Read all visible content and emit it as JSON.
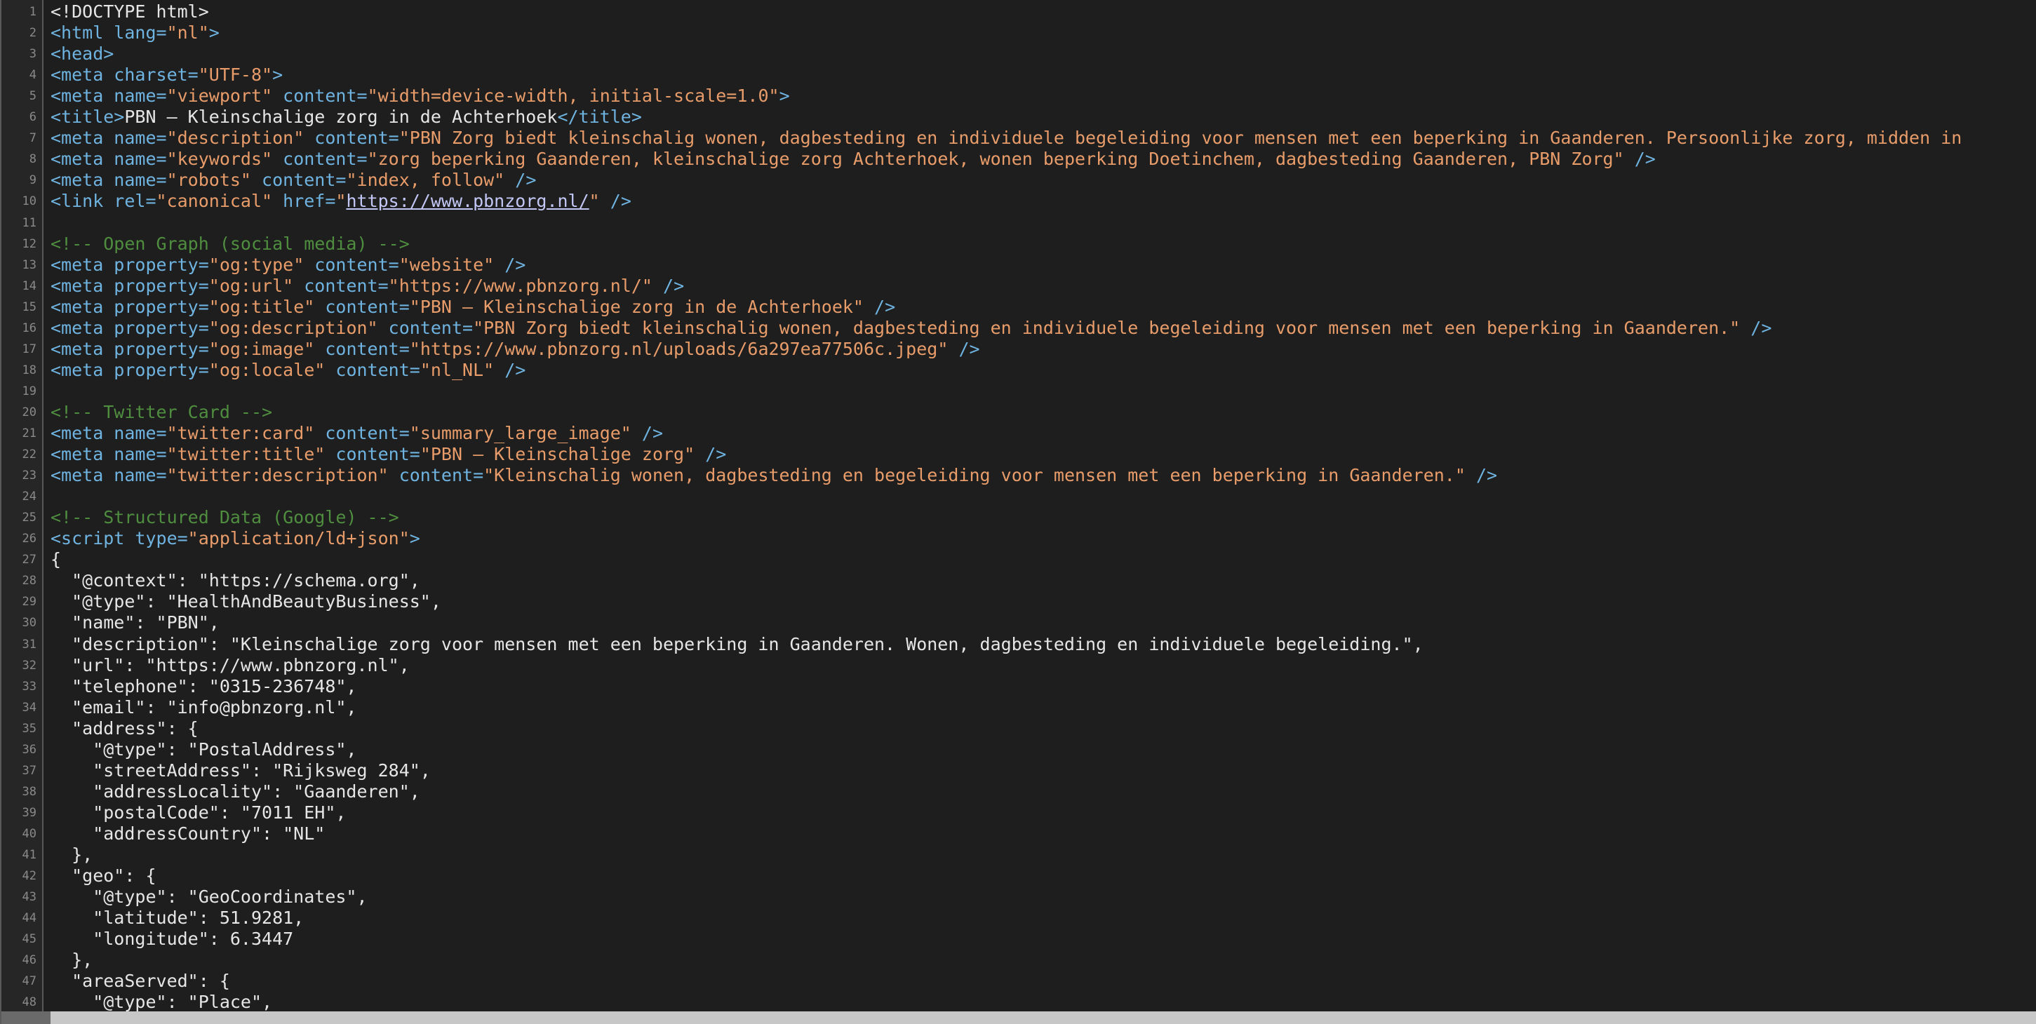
{
  "editor": {
    "line_numbers": [
      "1",
      "2",
      "3",
      "4",
      "5",
      "6",
      "7",
      "8",
      "9",
      "10",
      "11",
      "12",
      "13",
      "14",
      "15",
      "16",
      "17",
      "18",
      "19",
      "20",
      "21",
      "22",
      "23",
      "24",
      "25",
      "26",
      "27",
      "28",
      "29",
      "30",
      "31",
      "32",
      "33",
      "34",
      "35",
      "36",
      "37",
      "38",
      "39",
      "40",
      "41",
      "42",
      "43",
      "44",
      "45",
      "46",
      "47",
      "48"
    ],
    "lines": [
      [
        [
          "tx",
          "<!DOCTYPE html>"
        ]
      ],
      [
        [
          "tag",
          "<html lang="
        ],
        [
          "str",
          "\"nl\""
        ],
        [
          "tag",
          ">"
        ]
      ],
      [
        [
          "tag",
          "<head>"
        ]
      ],
      [
        [
          "tag",
          "<meta charset="
        ],
        [
          "str",
          "\"UTF-8\""
        ],
        [
          "tag",
          ">"
        ]
      ],
      [
        [
          "tag",
          "<meta name="
        ],
        [
          "str",
          "\"viewport\""
        ],
        [
          "tag",
          " content="
        ],
        [
          "str",
          "\"width=device-width, initial-scale=1.0\""
        ],
        [
          "tag",
          ">"
        ]
      ],
      [
        [
          "tag",
          "<title>"
        ],
        [
          "tx",
          "PBN – Kleinschalige zorg in de Achterhoek"
        ],
        [
          "tag",
          "</title>"
        ]
      ],
      [
        [
          "tag",
          "<meta name="
        ],
        [
          "str",
          "\"description\""
        ],
        [
          "tag",
          " content="
        ],
        [
          "str",
          "\"PBN Zorg biedt kleinschalig wonen, dagbesteding en individuele begeleiding voor mensen met een beperking in Gaanderen. Persoonlijke zorg, midden in"
        ]
      ],
      [
        [
          "tag",
          "<meta name="
        ],
        [
          "str",
          "\"keywords\""
        ],
        [
          "tag",
          " content="
        ],
        [
          "str",
          "\"zorg beperking Gaanderen, kleinschalige zorg Achterhoek, wonen beperking Doetinchem, dagbesteding Gaanderen, PBN Zorg\""
        ],
        [
          "tag",
          " />"
        ]
      ],
      [
        [
          "tag",
          "<meta name="
        ],
        [
          "str",
          "\"robots\""
        ],
        [
          "tag",
          " content="
        ],
        [
          "str",
          "\"index, follow\""
        ],
        [
          "tag",
          " />"
        ]
      ],
      [
        [
          "tag",
          "<link rel="
        ],
        [
          "str",
          "\"canonical\""
        ],
        [
          "tag",
          " href="
        ],
        [
          "str",
          "\""
        ],
        [
          "lnk",
          "https://www.pbnzorg.nl/"
        ],
        [
          "str",
          "\""
        ],
        [
          "tag",
          " />"
        ]
      ],
      [],
      [
        [
          "cmt",
          "<!-- Open Graph (social media) -->"
        ]
      ],
      [
        [
          "tag",
          "<meta property="
        ],
        [
          "str",
          "\"og:type\""
        ],
        [
          "tag",
          " content="
        ],
        [
          "str",
          "\"website\""
        ],
        [
          "tag",
          " />"
        ]
      ],
      [
        [
          "tag",
          "<meta property="
        ],
        [
          "str",
          "\"og:url\""
        ],
        [
          "tag",
          " content="
        ],
        [
          "str",
          "\"https://www.pbnzorg.nl/\""
        ],
        [
          "tag",
          " />"
        ]
      ],
      [
        [
          "tag",
          "<meta property="
        ],
        [
          "str",
          "\"og:title\""
        ],
        [
          "tag",
          " content="
        ],
        [
          "str",
          "\"PBN – Kleinschalige zorg in de Achterhoek\""
        ],
        [
          "tag",
          " />"
        ]
      ],
      [
        [
          "tag",
          "<meta property="
        ],
        [
          "str",
          "\"og:description\""
        ],
        [
          "tag",
          " content="
        ],
        [
          "str",
          "\"PBN Zorg biedt kleinschalig wonen, dagbesteding en individuele begeleiding voor mensen met een beperking in Gaanderen.\""
        ],
        [
          "tag",
          " />"
        ]
      ],
      [
        [
          "tag",
          "<meta property="
        ],
        [
          "str",
          "\"og:image\""
        ],
        [
          "tag",
          " content="
        ],
        [
          "str",
          "\"https://www.pbnzorg.nl/uploads/6a297ea77506c.jpeg\""
        ],
        [
          "tag",
          " />"
        ]
      ],
      [
        [
          "tag",
          "<meta property="
        ],
        [
          "str",
          "\"og:locale\""
        ],
        [
          "tag",
          " content="
        ],
        [
          "str",
          "\"nl_NL\""
        ],
        [
          "tag",
          " />"
        ]
      ],
      [],
      [
        [
          "cmt",
          "<!-- Twitter Card -->"
        ]
      ],
      [
        [
          "tag",
          "<meta name="
        ],
        [
          "str",
          "\"twitter:card\""
        ],
        [
          "tag",
          " content="
        ],
        [
          "str",
          "\"summary_large_image\""
        ],
        [
          "tag",
          " />"
        ]
      ],
      [
        [
          "tag",
          "<meta name="
        ],
        [
          "str",
          "\"twitter:title\""
        ],
        [
          "tag",
          " content="
        ],
        [
          "str",
          "\"PBN – Kleinschalige zorg\""
        ],
        [
          "tag",
          " />"
        ]
      ],
      [
        [
          "tag",
          "<meta name="
        ],
        [
          "str",
          "\"twitter:description\""
        ],
        [
          "tag",
          " content="
        ],
        [
          "str",
          "\"Kleinschalig wonen, dagbesteding en begeleiding voor mensen met een beperking in Gaanderen.\""
        ],
        [
          "tag",
          " />"
        ]
      ],
      [],
      [
        [
          "cmt",
          "<!-- Structured Data (Google) -->"
        ]
      ],
      [
        [
          "tag",
          "<script type="
        ],
        [
          "str",
          "\"application/ld+json\""
        ],
        [
          "tag",
          ">"
        ]
      ],
      [
        [
          "tx",
          "{"
        ]
      ],
      [
        [
          "tx",
          "  \"@context\": \"https://schema.org\","
        ]
      ],
      [
        [
          "tx",
          "  \"@type\": \"HealthAndBeautyBusiness\","
        ]
      ],
      [
        [
          "tx",
          "  \"name\": \"PBN\","
        ]
      ],
      [
        [
          "tx",
          "  \"description\": \"Kleinschalige zorg voor mensen met een beperking in Gaanderen. Wonen, dagbesteding en individuele begeleiding.\","
        ]
      ],
      [
        [
          "tx",
          "  \"url\": \"https://www.pbnzorg.nl\","
        ]
      ],
      [
        [
          "tx",
          "  \"telephone\": \"0315-236748\","
        ]
      ],
      [
        [
          "tx",
          "  \"email\": \"info@pbnzorg.nl\","
        ]
      ],
      [
        [
          "tx",
          "  \"address\": {"
        ]
      ],
      [
        [
          "tx",
          "    \"@type\": \"PostalAddress\","
        ]
      ],
      [
        [
          "tx",
          "    \"streetAddress\": \"Rijksweg 284\","
        ]
      ],
      [
        [
          "tx",
          "    \"addressLocality\": \"Gaanderen\","
        ]
      ],
      [
        [
          "tx",
          "    \"postalCode\": \"7011 EH\","
        ]
      ],
      [
        [
          "tx",
          "    \"addressCountry\": \"NL\""
        ]
      ],
      [
        [
          "tx",
          "  },"
        ]
      ],
      [
        [
          "tx",
          "  \"geo\": {"
        ]
      ],
      [
        [
          "tx",
          "    \"@type\": \"GeoCoordinates\","
        ]
      ],
      [
        [
          "tx",
          "    \"latitude\": 51.9281,"
        ]
      ],
      [
        [
          "tx",
          "    \"longitude\": 6.3447"
        ]
      ],
      [
        [
          "tx",
          "  },"
        ]
      ],
      [
        [
          "tx",
          "  \"areaServed\": {"
        ]
      ],
      [
        [
          "tx",
          "    \"@type\": \"Place\","
        ]
      ]
    ]
  }
}
